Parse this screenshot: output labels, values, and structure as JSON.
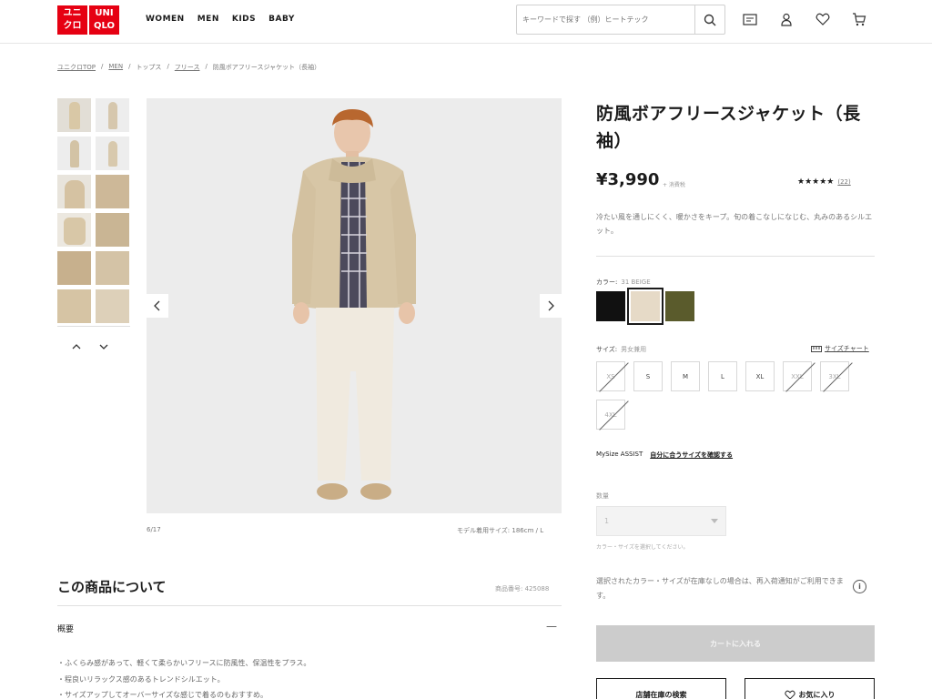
{
  "header": {
    "logo_top": "ユニ\nクロ",
    "logo_bottom": "UNI\nQLO",
    "nav": [
      "WOMEN",
      "MEN",
      "KIDS",
      "BABY"
    ],
    "search_placeholder": "キーワードで探す （例）ヒートテック",
    "icons": [
      "membership-card-icon",
      "user-icon",
      "heart-icon",
      "cart-icon"
    ]
  },
  "breadcrumb": [
    "ユニクロTOP",
    "MEN",
    "トップス",
    "フリース",
    "防風ボアフリースジャケット（長袖）"
  ],
  "gallery": {
    "counter": "6/17",
    "model_size": "モデル着用サイズ: 186cm / L"
  },
  "product": {
    "title": "防風ボアフリースジャケット（長袖）",
    "price": "¥3,990",
    "tax": "+ 消費税",
    "rating_stars": "★★★★★",
    "rating_value": 4.5,
    "review_count": "(22)",
    "description": "冷たい風を通しにくく、暖かさをキープ。旬の着こなしになじむ、丸みのあるシルエット。",
    "color_label": "カラー:",
    "color_value": "31 BEIGE",
    "colors": [
      {
        "name": "black",
        "hex": "#111111",
        "selected": false
      },
      {
        "name": "beige",
        "hex": "#e6dac7",
        "selected": true
      },
      {
        "name": "olive",
        "hex": "#5a5b2c",
        "selected": false
      }
    ],
    "size_label": "サイズ:",
    "size_value": "男女兼用",
    "size_chart": "サイズチャート",
    "sizes": [
      {
        "label": "XS",
        "available": false
      },
      {
        "label": "S",
        "available": true
      },
      {
        "label": "M",
        "available": true
      },
      {
        "label": "L",
        "available": true
      },
      {
        "label": "XL",
        "available": true
      },
      {
        "label": "XXL",
        "available": false
      },
      {
        "label": "3XL",
        "available": false
      },
      {
        "label": "4XL",
        "available": false
      }
    ],
    "mysize_label": "MySize ASSIST",
    "mysize_link": "自分に合うサイズを確認する",
    "qty_label": "数量",
    "qty_value": "1",
    "qty_note": "カラー・サイズを選択してください。",
    "restock": "選択されたカラー・サイズが在庫なしの場合は、再入荷通知がご利用できます。",
    "add_to_cart": "カートに入れる",
    "store_stock": "店舗在庫の検索",
    "favorite": "お気に入り"
  },
  "about": {
    "title": "この商品について",
    "item_no": "商品番号: 425088",
    "overview": "概要",
    "toggle": "—",
    "features": [
      "・ふくらみ感があって、軽くて柔らかいフリースに防風性、保温性をプラス。",
      "・程良いリラックス感のあるトレンドシルエット。",
      "・サイズアップしてオーバーサイズな感じで着るのもおすすめ。"
    ]
  },
  "colors": {
    "brand_red": "#e60012",
    "disabled_btn": "#cccccc"
  }
}
